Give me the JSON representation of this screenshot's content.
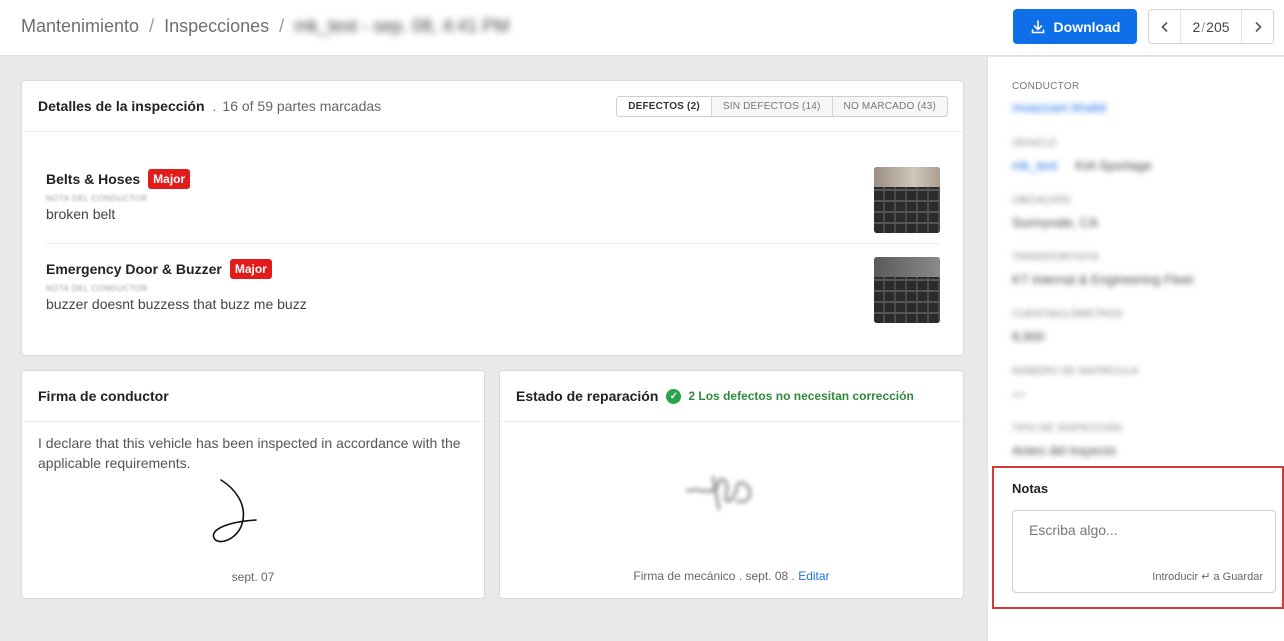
{
  "breadcrumb": {
    "items": [
      "Mantenimiento",
      "Inspecciones"
    ],
    "current": "mk_test - sep. 08, 4:41 PM"
  },
  "toolbar": {
    "download_label": "Download",
    "page_current": "2",
    "page_total": "205"
  },
  "details": {
    "title": "Detalles de la inspección",
    "subtitle": "16 of 59 partes marcadas",
    "filters": [
      "DEFECTOS (2)",
      "SIN DEFECTOS (14)",
      "NO MARCADO (43)"
    ],
    "active_filter": "DEFECTOS (2)",
    "defects": [
      {
        "name": "Belts & Hoses",
        "severity": "Major",
        "meta": "NOTA DEL CONDUCTOR",
        "note": "broken belt"
      },
      {
        "name": "Emergency Door & Buzzer",
        "severity": "Major",
        "meta": "NOTA DEL CONDUCTOR",
        "note": "buzzer doesnt buzzess that buzz me buzz"
      }
    ]
  },
  "driver_signature": {
    "title": "Firma de conductor",
    "declaration": "I declare that this vehicle has been inspected in accordance with the applicable requirements.",
    "date": "sept. 07"
  },
  "repair": {
    "title": "Estado de reparación",
    "status": "2 Los defectos no necesitan corrección",
    "footer_label": "Firma de mecánico",
    "footer_date": "sept. 08",
    "edit_label": "Editar"
  },
  "sidebar": {
    "conductor_label": "CONDUCTOR",
    "conductor_value": "moazzam khalid",
    "vehicle_label": "VEHICLE",
    "vehicle_link": "mk_test",
    "vehicle_value": "KIA Sportage",
    "location_label": "UBICACIÓN",
    "location_value": "Sunnyvale, CA",
    "carrier_label": "TRANSPORTISTA",
    "carrier_value": "KT Internal & Engineering Fleet",
    "odometer_label": "CUENTAKILÓMETROS",
    "odometer_value": "8,900",
    "plate_label": "NÚMERO DE MATRÍCULA",
    "plate_value": "—",
    "type_label": "TIPO DE INSPECCIÓN",
    "type_value": "Antes del trayecto"
  },
  "notes": {
    "title": "Notas",
    "placeholder": "Escriba algo...",
    "hint": "Introducir ↵ a Guardar"
  },
  "colors": {
    "primary": "#0f6fe8",
    "major_badge": "#e21b1b",
    "success": "#2e8b3e",
    "highlight_border": "#d23b3b"
  }
}
